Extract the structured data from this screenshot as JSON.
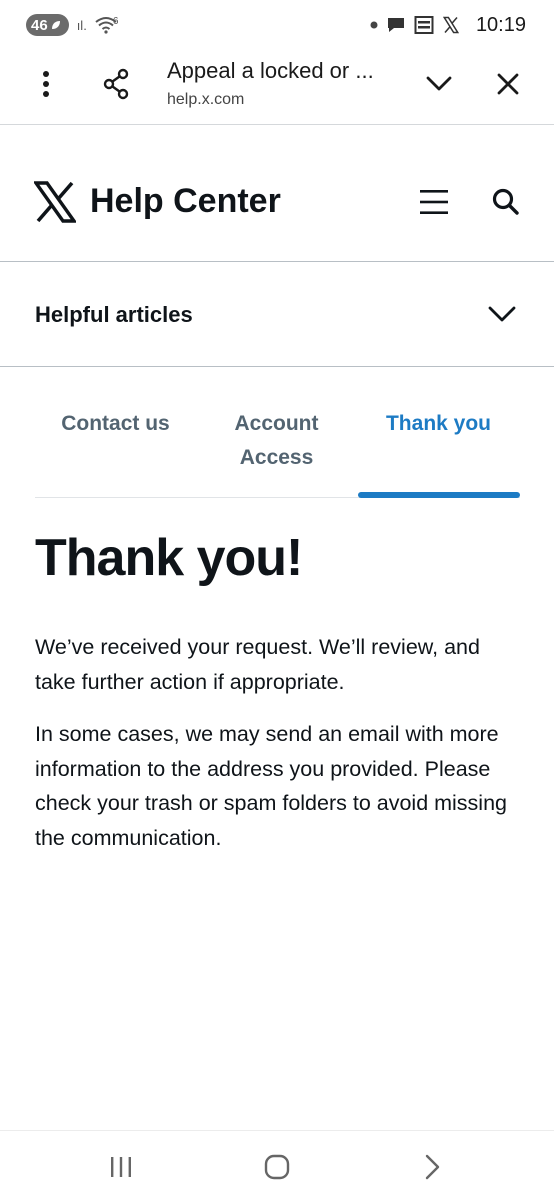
{
  "status_bar": {
    "network_badge": "46",
    "signal_label": "ıl.",
    "wifi_label": "6",
    "time": "10:19",
    "icons": [
      "notification-dot-icon",
      "chat-bubble-icon",
      "message-icon",
      "x-logo-icon"
    ]
  },
  "browser_tab": {
    "page_title": "Appeal a locked or ...",
    "url": "help.x.com",
    "icons": [
      "more-vert-icon",
      "share-icon",
      "chevron-down-icon",
      "close-icon"
    ]
  },
  "header": {
    "title": "Help Center",
    "icons": [
      "x-logo-icon",
      "hamburger-menu-icon",
      "search-icon"
    ]
  },
  "helpful_articles": {
    "label": "Helpful articles"
  },
  "steps": [
    {
      "label": "Contact us",
      "active": false
    },
    {
      "label": "Account Access",
      "line1": "Account",
      "line2": "Access",
      "active": false
    },
    {
      "label": "Thank you",
      "active": true
    }
  ],
  "content": {
    "heading": "Thank you!",
    "paragraph_1": "We’ve received your request. We’ll review, and take further action if appropriate.",
    "paragraph_2": "In some cases, we may send an email with more information to the address you provided. Please check your trash or spam folders to avoid missing the communication."
  },
  "nav_bar": {
    "icons": [
      "recent-apps-icon",
      "home-icon",
      "back-icon"
    ]
  },
  "colors": {
    "accent": "#1d7bc4",
    "text": "#0f1419",
    "muted_tab": "#536471",
    "divider": "#b8bfc5"
  }
}
